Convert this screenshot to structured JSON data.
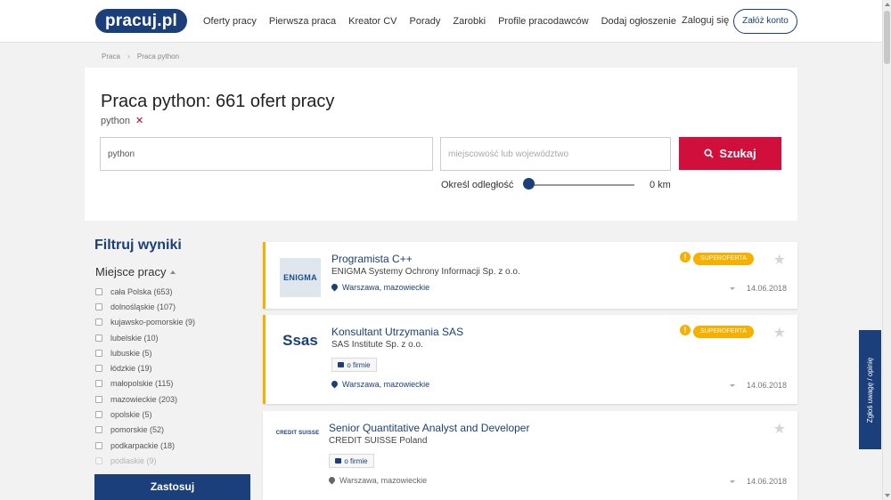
{
  "header": {
    "logo": "pracuj.pl",
    "nav": [
      "Oferty pracy",
      "Pierwsza praca",
      "Kreator CV",
      "Porady",
      "Zarobki",
      "Profile pracodawców",
      "Dodaj ogłoszenie"
    ],
    "login": "Zaloguj się",
    "signup": "Załóż konto"
  },
  "breadcrumb": [
    "Praca",
    "Praca python"
  ],
  "search": {
    "title": "Praca python:  661 ofert pracy",
    "tag": "python",
    "keyword_value": "python",
    "location_placeholder": "miejscowość lub województwo",
    "button": "Szukaj",
    "distance_label": "Określ odległość",
    "distance_value": "0 km"
  },
  "filters": {
    "title": "Filtruj wyniki",
    "section": "Miejsce pracy",
    "items": [
      "cała Polska (653)",
      "dolnośląskie (107)",
      "kujawsko-pomorskie (9)",
      "lubelskie (10)",
      "lubuskie (5)",
      "łódzkie (19)",
      "małopolskie (115)",
      "mazowieckie (203)",
      "opolskie (5)",
      "pomorskie (52)",
      "podkarpackie (18)",
      "podlaskie (9)"
    ],
    "apply": "Zastosuj"
  },
  "offers": [
    {
      "title": "Programista C++",
      "company": "ENIGMA Systemy Ochrony Informacji Sp. z o.o.",
      "location": "Warszawa, mazowieckie",
      "date": "14.06.2018",
      "badge": "SUPEROFERTA",
      "logo": "ENIGMA"
    },
    {
      "title": "Konsultant Utrzymania SAS",
      "company": "SAS Institute Sp. z o.o.",
      "location": "Warszawa, mazowieckie",
      "date": "14.06.2018",
      "badge": "SUPEROFERTA",
      "about": "o firmie",
      "logo": "Ssas"
    },
    {
      "title": "Senior Quantitative Analyst and Developer",
      "company": "CREDIT SUISSE Poland",
      "location": "Warszawa, mazowieckie",
      "date": "14.06.2018",
      "about": "o firmie",
      "logo": "CREDIT SUISSE"
    }
  ],
  "feedback": "Zgłoś uwagę / opinię"
}
